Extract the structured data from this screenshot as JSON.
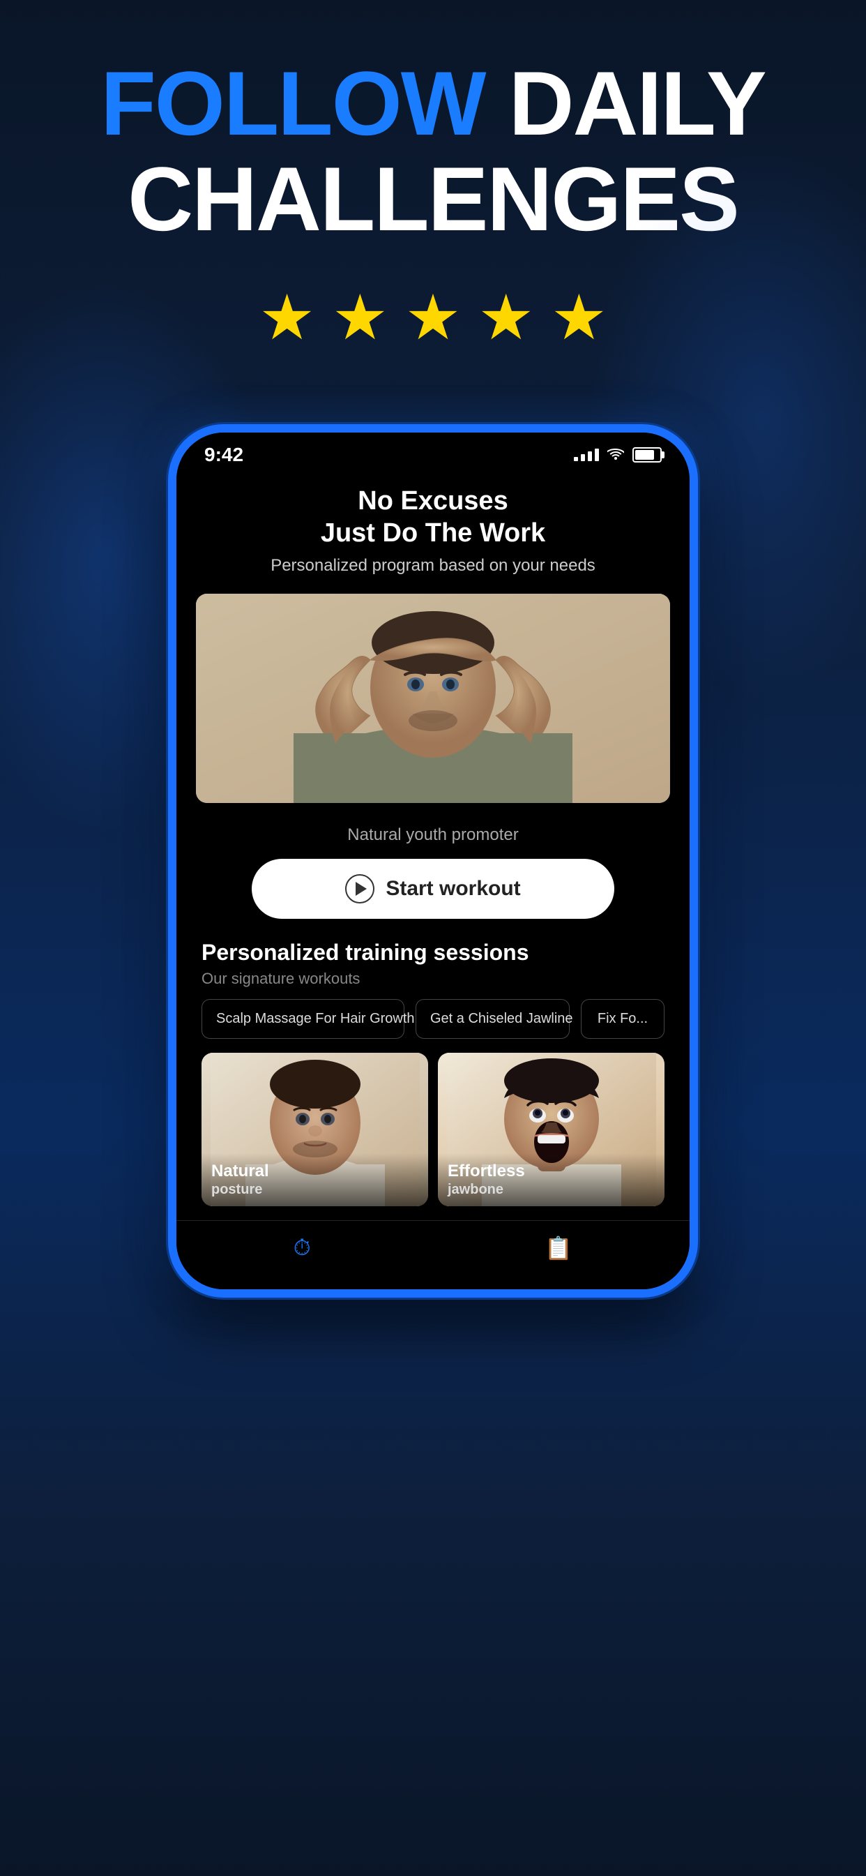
{
  "headline": {
    "part1": "FOLLOW ",
    "part2": "DAILY",
    "part3": "CHALLENGES"
  },
  "stars": {
    "count": 5,
    "symbol": "★"
  },
  "statusBar": {
    "time": "9:42",
    "color": "#ffffff"
  },
  "appScreen": {
    "title": "No Excuses\nJust Do The Work",
    "subtitle": "Personalized program based on your needs",
    "promoText": "Natural youth promoter",
    "startButton": "Start workout"
  },
  "trainingSection": {
    "title": "Personalized training sessions",
    "subtitle": "Our signature workouts",
    "pills": [
      {
        "label": "Scalp Massage For Hair Growth"
      },
      {
        "label": "Get a Chiseled Jawline"
      },
      {
        "label": "Fix Fo..."
      }
    ],
    "cards": [
      {
        "label": "Natural",
        "sublabel": "posture"
      },
      {
        "label": "Effortless",
        "sublabel": "jawbone"
      }
    ]
  },
  "nav": {
    "icons": [
      {
        "symbol": "⏱",
        "name": "timer-icon"
      },
      {
        "symbol": "📋",
        "name": "clipboard-icon"
      }
    ]
  },
  "colors": {
    "accent": "#1a7cff",
    "highlight": "#1a7cff",
    "star": "#FFD700",
    "bg": "#0a1628"
  }
}
